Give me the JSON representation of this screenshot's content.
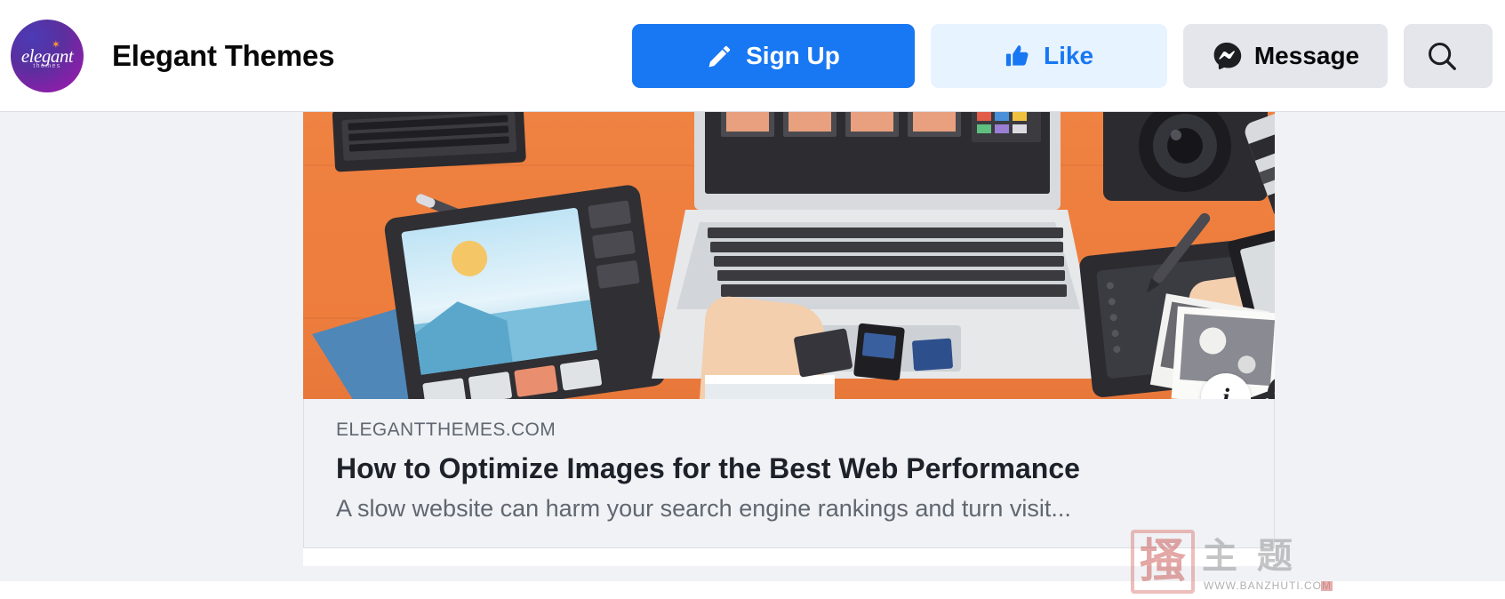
{
  "header": {
    "page_name": "Elegant Themes",
    "avatar": {
      "word": "elegant",
      "sub": "themes",
      "star": "✶"
    },
    "buttons": [
      {
        "name": "sign-up",
        "label": "Sign Up",
        "icon": "pencil-icon",
        "style": "primary"
      },
      {
        "name": "like",
        "label": "Like",
        "icon": "thumbs-up-icon",
        "style": "light-blue"
      },
      {
        "name": "message",
        "label": "Message",
        "icon": "messenger-icon",
        "style": "grey"
      },
      {
        "name": "search",
        "label": "",
        "icon": "search-icon",
        "style": "grey"
      }
    ]
  },
  "post": {
    "image_alt": "flat illustration of a designer desk with laptop, tablet, camera and drawing tablet on an orange desktop",
    "info_badge": {
      "icon": "info-icon",
      "glyph": "i"
    },
    "link_preview": {
      "domain": "ELEGANTTHEMES.COM",
      "title": "How to Optimize Images for the Best Web Performance",
      "description": "A slow website can harm your search engine rankings and turn visit..."
    }
  },
  "watermark": {
    "seal_char": "搔",
    "cn_text": "主 题",
    "url": "WWW.BANZHUTI.COM"
  },
  "colors": {
    "facebook_blue": "#1877f2",
    "light_blue_bg": "#e7f3ff",
    "grey_button_bg": "#e4e6eb",
    "feed_bg": "#f0f2f5",
    "card_meta_bg": "#f0f2f5",
    "text_primary": "#1d2129",
    "text_secondary": "#606770",
    "image_orange": "#ef7f3e"
  }
}
